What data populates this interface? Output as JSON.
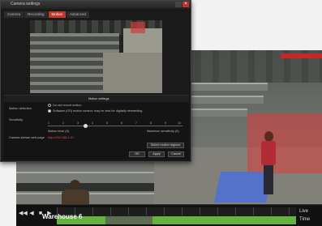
{
  "dialog": {
    "title": "Camera settings",
    "tabs": [
      {
        "label": "Camera",
        "active": false
      },
      {
        "label": "Recording",
        "active": false
      },
      {
        "label": "Motion",
        "active": true
      },
      {
        "label": "Advanced",
        "active": false
      }
    ],
    "panel": {
      "header": "Motion settings",
      "motion_detection_label": "Motion detection",
      "option_off": "Do not record motion",
      "option_on": "Software (OS) motion sensor; may be less for digitally demanding",
      "sensitivity_label": "Sensitivity",
      "scale": [
        "1",
        "2",
        "3",
        "4",
        "5",
        "6",
        "7",
        "8",
        "9",
        "10"
      ],
      "motion_level_label": "Motion level (0)",
      "max_sensitivity_label": "Maximum sensitivity (5)",
      "camera_stream_label": "Camera stream web page",
      "camera_stream_link": "http://192.168.1.10",
      "select_motion_regions": "Select motion regions",
      "buttons": {
        "ok": "OK",
        "apply": "Apply",
        "cancel": "Cancel"
      }
    },
    "close_glyph": "×"
  },
  "player": {
    "controls": [
      "◀◀",
      "◀",
      "■",
      "▶"
    ],
    "track_label": "Warehouse 6",
    "right_top": "Live",
    "right_bottom": "Time"
  },
  "colors": {
    "accent_red": "#c0392b",
    "timeline_green": "#63b33e",
    "motion_zone_red": "#dc3c3c",
    "motion_zone_blue": "#466ee6"
  }
}
